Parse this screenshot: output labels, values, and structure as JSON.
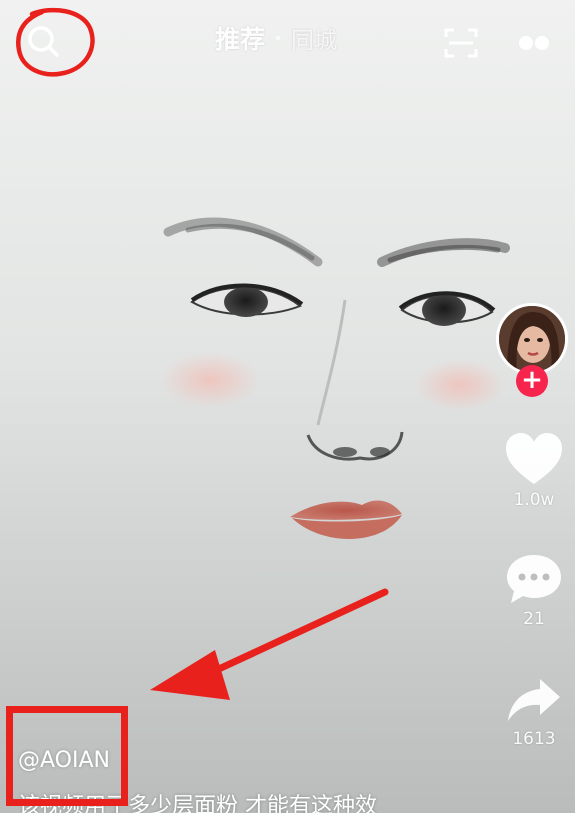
{
  "top_bar": {
    "tabs": [
      {
        "label": "推荐",
        "active": true
      },
      {
        "label": "同城",
        "active": false
      }
    ]
  },
  "icons": {
    "search": "search-icon",
    "scan": "scan-icon",
    "more": "more-icon",
    "like": "heart-icon",
    "comment": "comment-icon",
    "share": "share-icon"
  },
  "rail": {
    "follow_symbol": "+",
    "likes": "1.0w",
    "comments": "21",
    "shares": "1613"
  },
  "video": {
    "author": "@AOIAN",
    "caption": "该视频用了多少层面粉 才能有这种效"
  },
  "colors": {
    "annotation_red": "#e8211d",
    "follow_pink": "#f7254e"
  }
}
